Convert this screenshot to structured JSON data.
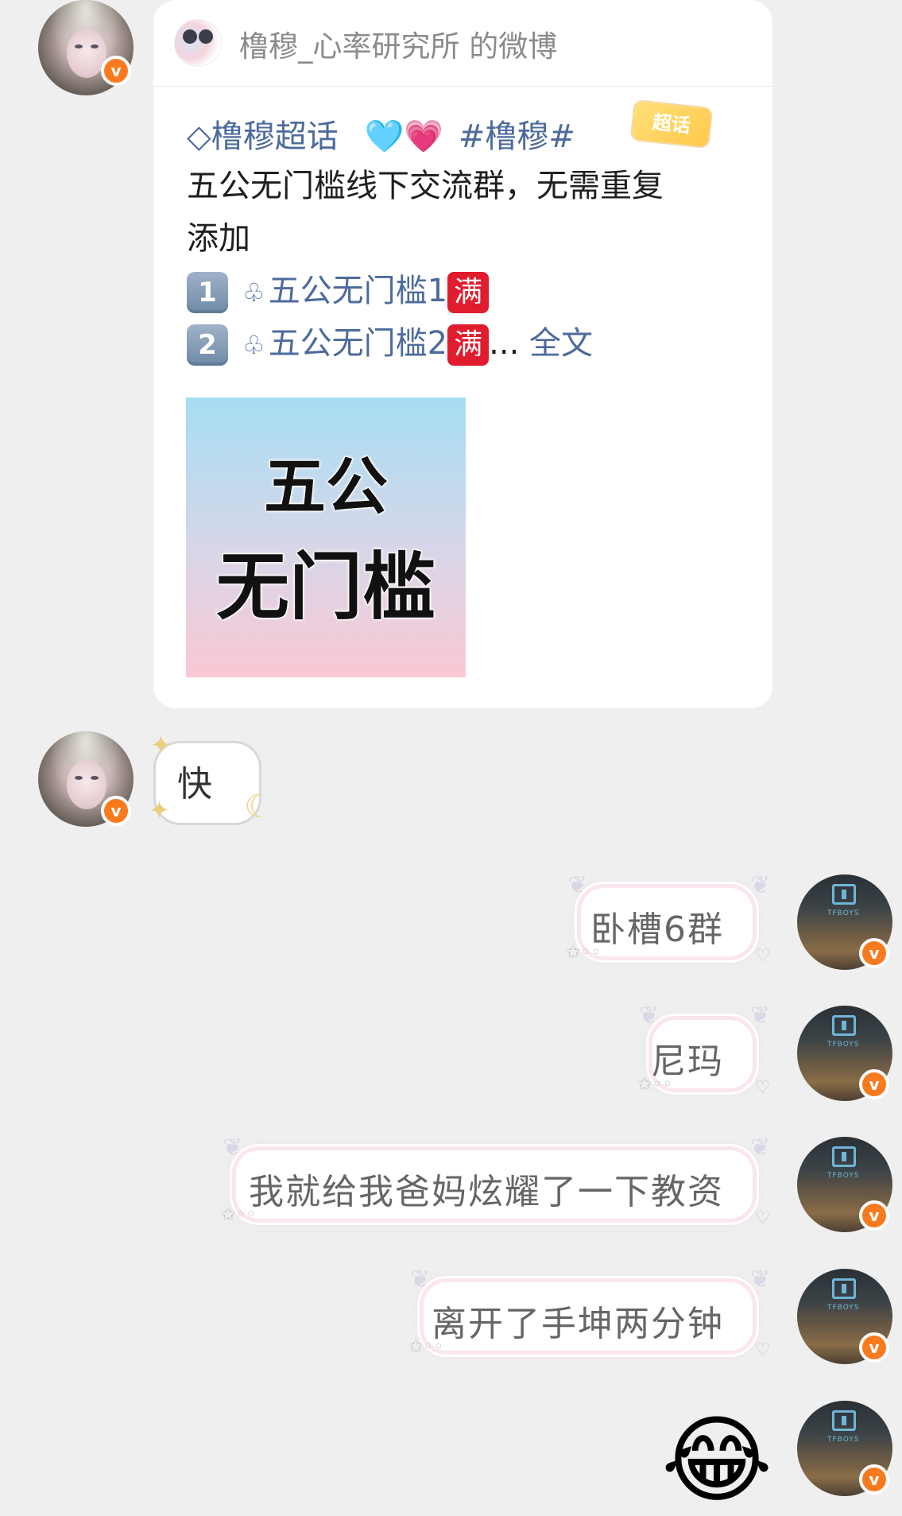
{
  "colors": {
    "background": "#efefef",
    "card_bg": "#ffffff",
    "link_blue": "#4d6b9c",
    "verified_orange": "#f87a1e",
    "full_badge_red": "#e01c2e"
  },
  "shared_post": {
    "source_label": "橹穆_心率研究所 的微博",
    "topic_icon": "diamond-icon",
    "topic_name": "橹穆超话",
    "hearts": "🩵💗",
    "hashtag": "#橹穆#",
    "chaohua_badge": "超话",
    "text_line1": "五公无门槛线下交流群，无需重复",
    "text_line2": "添加",
    "item1": {
      "num": "1",
      "group_name": "五公无门槛1",
      "full_badge": "满"
    },
    "item2": {
      "num": "2",
      "group_name": "五公无门槛2",
      "full_badge": "满",
      "ellipsis": "...",
      "full_text_link": "全文"
    },
    "image_text_line1": "五公",
    "image_text_line2": "无门槛"
  },
  "messages": [
    {
      "side": "left",
      "text": "快"
    },
    {
      "side": "right",
      "text": "卧槽6群"
    },
    {
      "side": "right",
      "text": "尼玛"
    },
    {
      "side": "right",
      "text": "我就给我爸妈炫耀了一下教资"
    },
    {
      "side": "right",
      "text": "离开了手坤两分钟"
    },
    {
      "side": "right",
      "emoji": "😂"
    }
  ],
  "avatars": {
    "right_logo_text": "TFBOYS",
    "verified_mark": "v"
  }
}
